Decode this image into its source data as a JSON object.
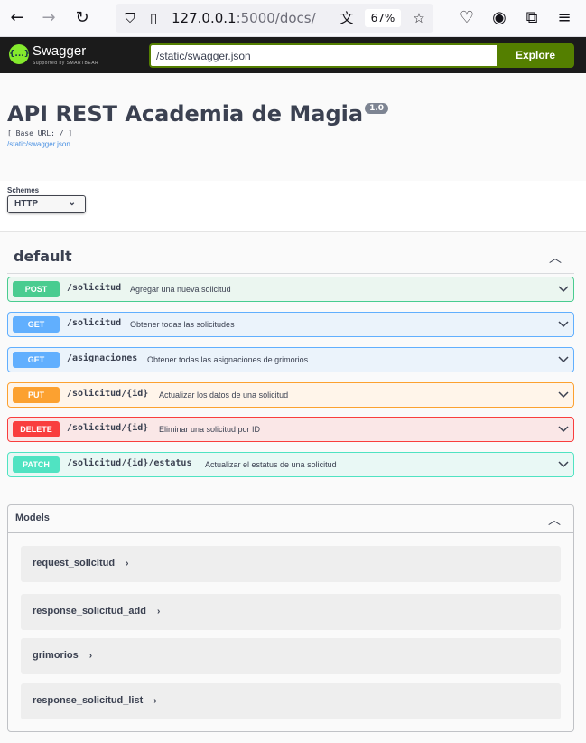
{
  "browser": {
    "url_host": "127.0.0.1",
    "url_rest": ":5000/docs/",
    "zoom": "67%"
  },
  "topbar": {
    "logo_text": "Swagger",
    "logo_sub": "Supported by SMARTBEAR",
    "logo_glyph": "{...}",
    "spec_url": "/static/swagger.json",
    "explore_label": "Explore"
  },
  "info": {
    "title": "API REST Academia de Magia",
    "version": "1.0",
    "base_url": "[ Base URL: / ]",
    "spec_link": "/static/swagger.json"
  },
  "schemes": {
    "label": "Schemes",
    "selected": "HTTP"
  },
  "tag": {
    "name": "default"
  },
  "operations": [
    {
      "method": "POST",
      "path": "/solicitud",
      "summary": "Agregar una nueva solicitud"
    },
    {
      "method": "GET",
      "path": "/solicitud",
      "summary": "Obtener todas las solicitudes"
    },
    {
      "method": "GET",
      "path": "/asignaciones",
      "summary": "Obtener todas las asignaciones de grimorios"
    },
    {
      "method": "PUT",
      "path": "/solicitud/{id}",
      "summary": "Actualizar los datos de una solicitud"
    },
    {
      "method": "DELETE",
      "path": "/solicitud/{id}",
      "summary": "Eliminar una solicitud por ID"
    },
    {
      "method": "PATCH",
      "path": "/solicitud/{id}/estatus",
      "summary": "Actualizar el estatus de una solicitud"
    }
  ],
  "models": {
    "title": "Models",
    "items": [
      "request_solicitud",
      "response_solicitud_add",
      "grimorios",
      "response_solicitud_list"
    ]
  },
  "colors": {
    "post": "#49cc90",
    "get": "#61affe",
    "put": "#fca130",
    "delete": "#f93e3e",
    "patch": "#50e3c2",
    "explore": "#547f00"
  }
}
